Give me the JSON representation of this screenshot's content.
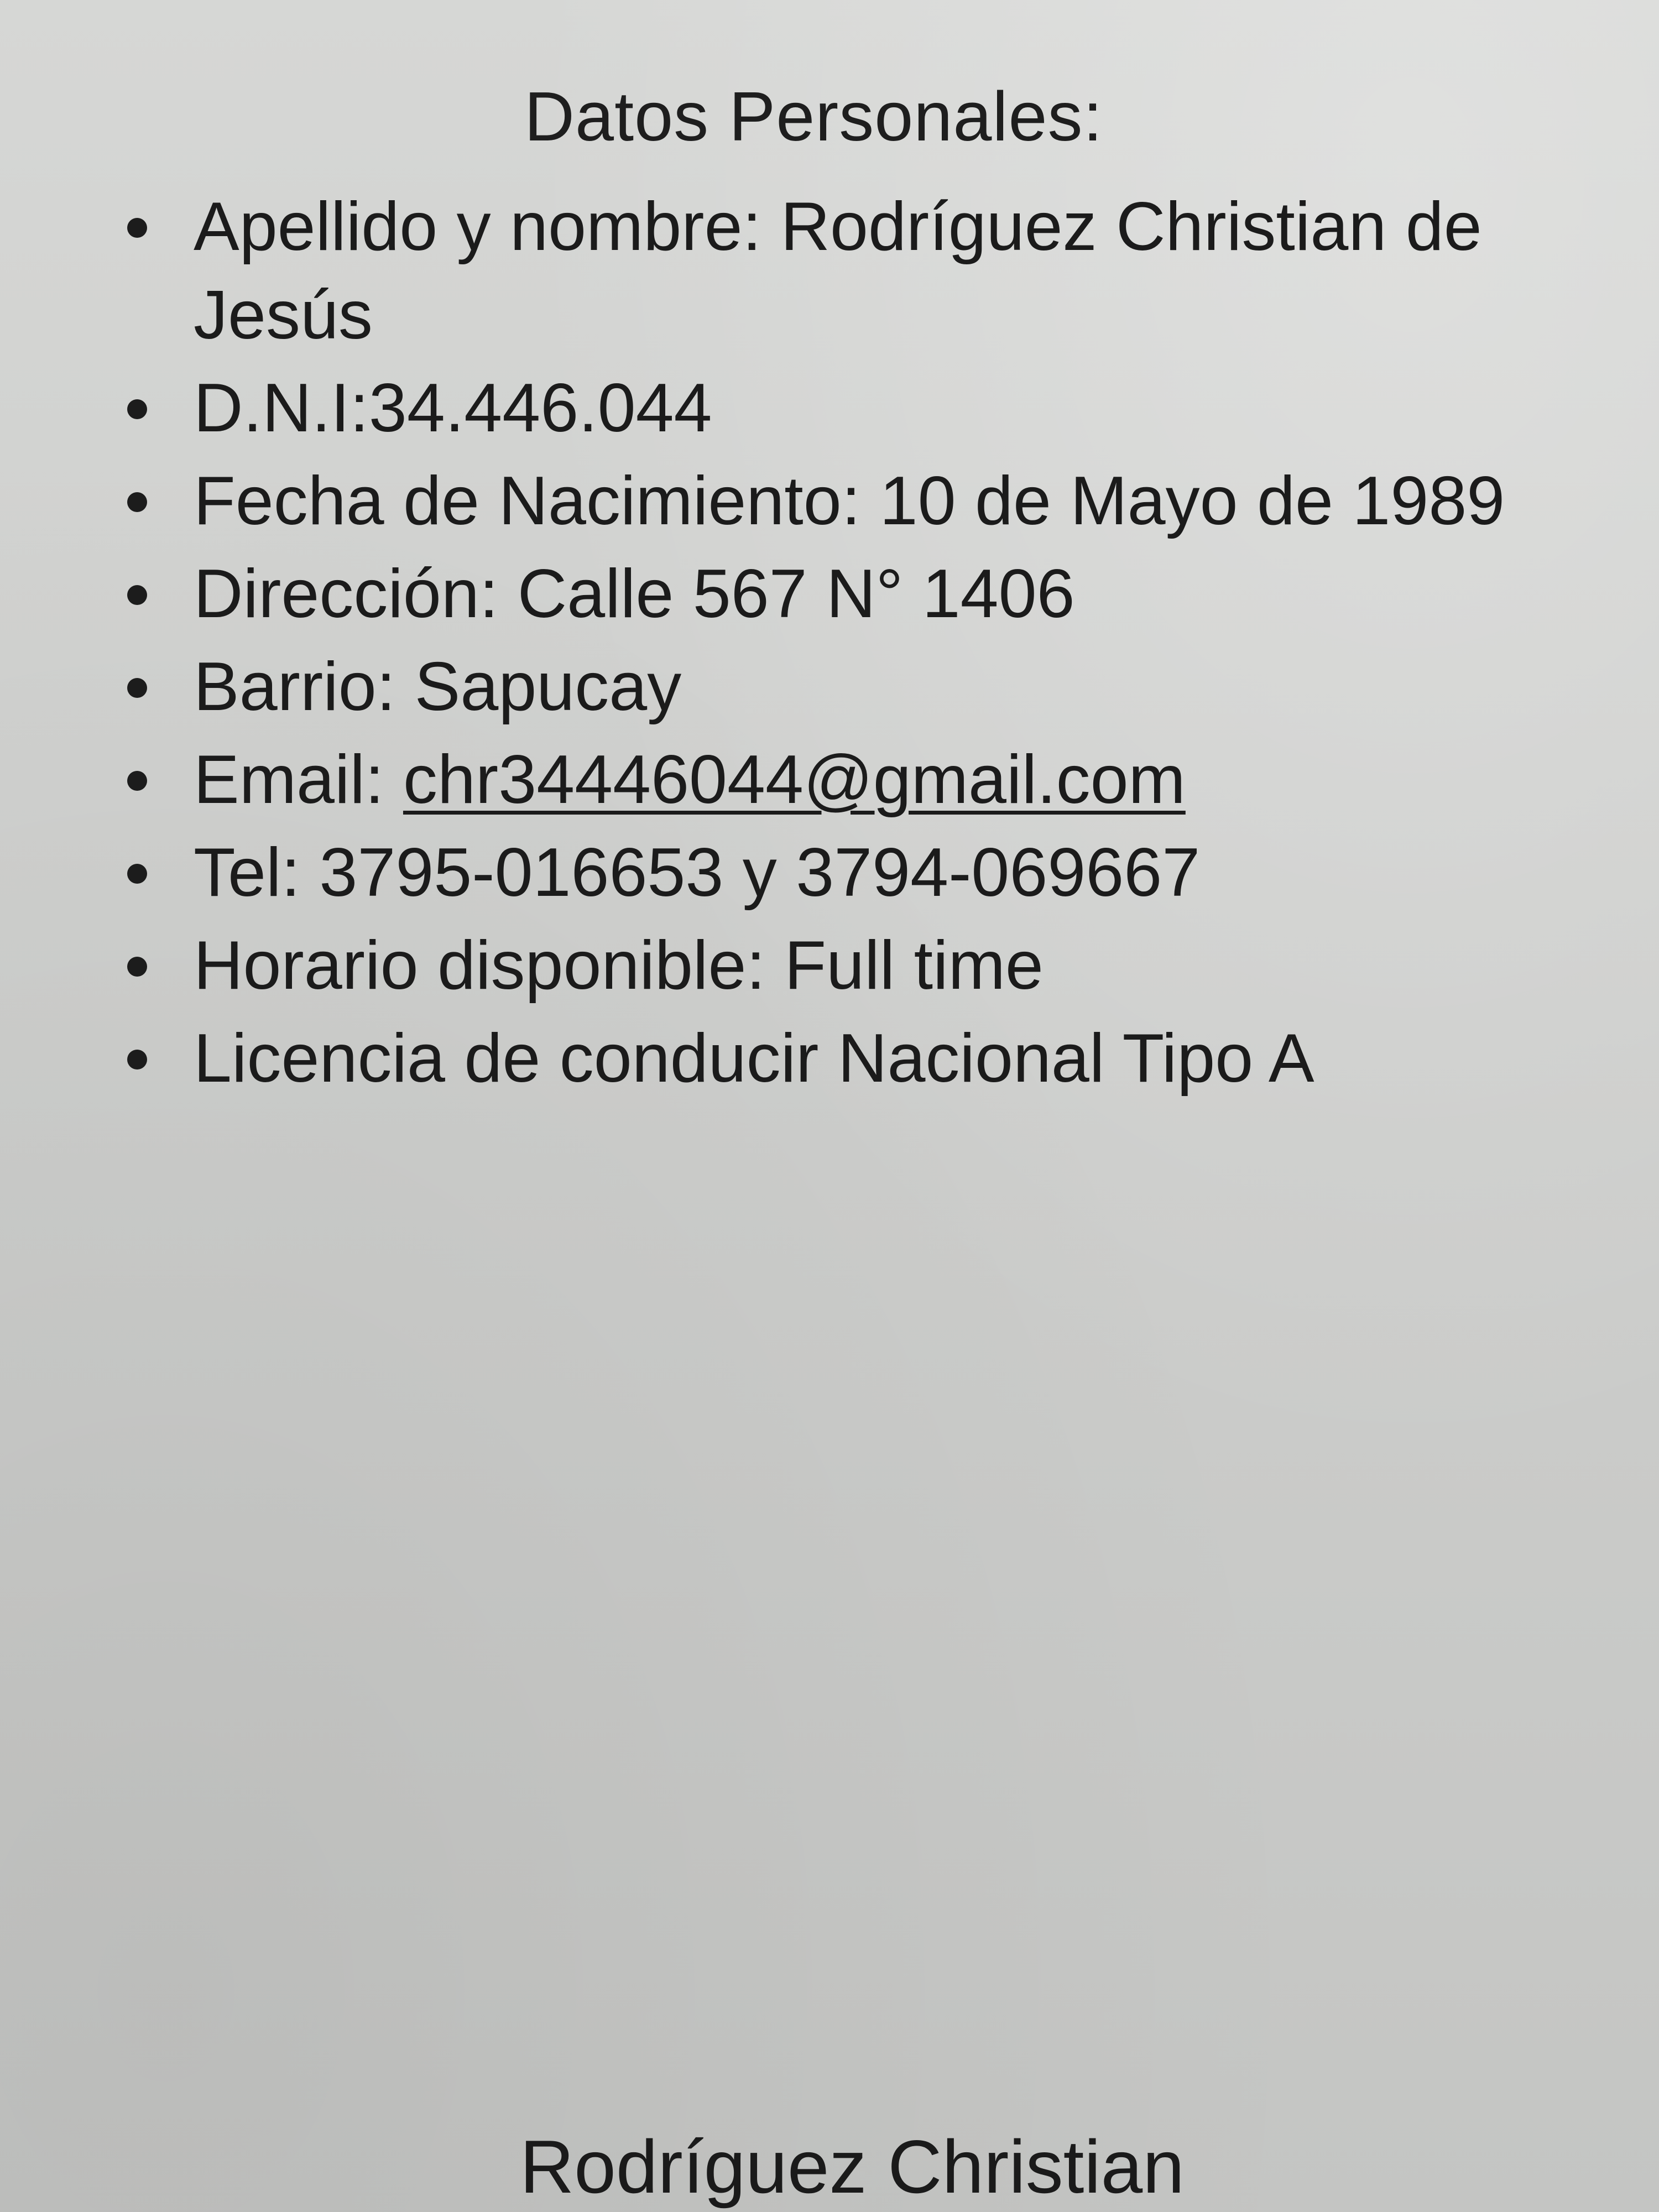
{
  "document": {
    "heading": "Datos Personales:",
    "items": [
      {
        "label": "Apellido y nombre:",
        "value": "Rodríguez Christian de Jesús"
      },
      {
        "label": "D.N.I:",
        "value": "34.446.044"
      },
      {
        "label": "Fecha de Nacimiento:",
        "value": "10 de Mayo de 1989"
      },
      {
        "label": "Dirección:",
        "value": "Calle 567 N° 1406"
      },
      {
        "label": "Barrio:",
        "value": "Sapucay"
      },
      {
        "label": "Email:",
        "value": "chr34446044@gmail.com"
      },
      {
        "label": "Tel:",
        "value": "3795-016653 y 3794-069667"
      },
      {
        "label": "Horario disponible:",
        "value": "Full time"
      },
      {
        "label": "",
        "value": "Licencia de conducir Nacional Tipo A"
      }
    ],
    "footer_name": "Rodríguez Christian"
  }
}
